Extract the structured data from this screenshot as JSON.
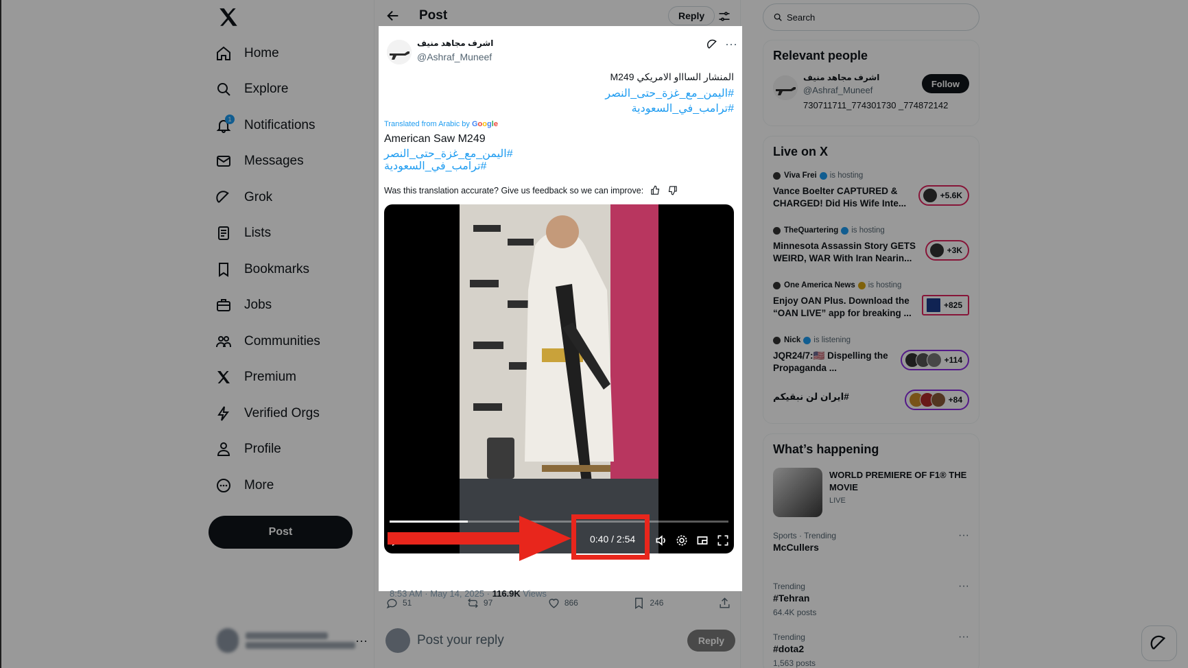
{
  "nav": {
    "items": [
      {
        "label": "Home",
        "icon": "home-icon"
      },
      {
        "label": "Explore",
        "icon": "search-icon"
      },
      {
        "label": "Notifications",
        "icon": "bell-icon",
        "badge": "1"
      },
      {
        "label": "Messages",
        "icon": "mail-icon"
      },
      {
        "label": "Grok",
        "icon": "grok-icon"
      },
      {
        "label": "Lists",
        "icon": "list-icon"
      },
      {
        "label": "Bookmarks",
        "icon": "bookmark-icon"
      },
      {
        "label": "Jobs",
        "icon": "briefcase-icon"
      },
      {
        "label": "Communities",
        "icon": "communities-icon"
      },
      {
        "label": "Premium",
        "icon": "x-logo-icon"
      },
      {
        "label": "Verified Orgs",
        "icon": "lightning-icon"
      },
      {
        "label": "Profile",
        "icon": "person-icon"
      },
      {
        "label": "More",
        "icon": "more-circle-icon"
      }
    ],
    "post_button": "Post"
  },
  "header": {
    "title": "Post",
    "reply_button": "Reply"
  },
  "post": {
    "author_name": "اشرف مجاهد منيف",
    "author_handle": "@Ashraf_Muneef",
    "original_line1": "المنشار الساااو الامريكي M249",
    "original_tag1": "#اليمن_مع_غزة_حتى_النصر",
    "original_tag2": "#ترامب_في_السعودية",
    "translated_label": "Translated from Arabic by",
    "translated_line1": "American Saw M249",
    "translated_tag1": "#اليمن_مع_غزة_حتى_النصر",
    "translated_tag2": "#ترامب_في_السعودية",
    "feedback_text": "Was this translation accurate? Give us feedback so we can improve:",
    "video": {
      "time": "0:40 / 2:54",
      "progress": 0.23
    },
    "timestamp": "8:53 AM · May 14, 2025 · ",
    "views_count": "116.9K",
    "views_label": " Views",
    "stats": {
      "replies": "51",
      "reposts": "97",
      "likes": "866",
      "bookmarks": "246"
    },
    "reply_placeholder": "Post your reply",
    "reply_submit": "Reply"
  },
  "search": {
    "placeholder": "Search"
  },
  "relevant": {
    "title": "Relevant people",
    "name": "اشرف مجاهد منيف",
    "handle": "@Ashraf_Muneef",
    "bio": "730711711_774301730 _774872142",
    "follow": "Follow"
  },
  "live": {
    "title": "Live on X",
    "items": [
      {
        "host": "Viva Frei",
        "status": "is hosting",
        "title": "Vance Boelter CAPTURED & CHARGED! Did His Wife Inte...",
        "count": "+5.6K"
      },
      {
        "host": "TheQuartering",
        "status": "is hosting",
        "title": "Minnesota Assassin Story GETS WEIRD, WAR With Iran Nearin...",
        "count": "+3K"
      },
      {
        "host": "One America News",
        "status": "is hosting",
        "title": "Enjoy OAN Plus. Download the “OAN LIVE” app for breaking ...",
        "count": "+825"
      },
      {
        "host": "Nick",
        "status": "is listening",
        "title": "JQR24/7:🇺🇸 Dispelling the Propaganda ...",
        "count": "+114"
      },
      {
        "host": "",
        "status": "",
        "title": "#ايران لن نبقيكم",
        "count": "+84"
      }
    ]
  },
  "happening": {
    "title": "What’s happening",
    "featured_title": "WORLD PREMIERE OF F1® THE MOVIE",
    "featured_status": "LIVE",
    "trends": [
      {
        "meta": "Sports · Trending",
        "name": "McCullers",
        "count": ""
      },
      {
        "meta": "Trending",
        "name": "#Tehran",
        "count": "64.4K posts"
      },
      {
        "meta": "Trending",
        "name": "#dota2",
        "count": "1,563 posts"
      }
    ]
  },
  "colors": {
    "accent": "#1d9bf0",
    "annotation": "#e8261c",
    "live_pill": "#8a2be2"
  }
}
